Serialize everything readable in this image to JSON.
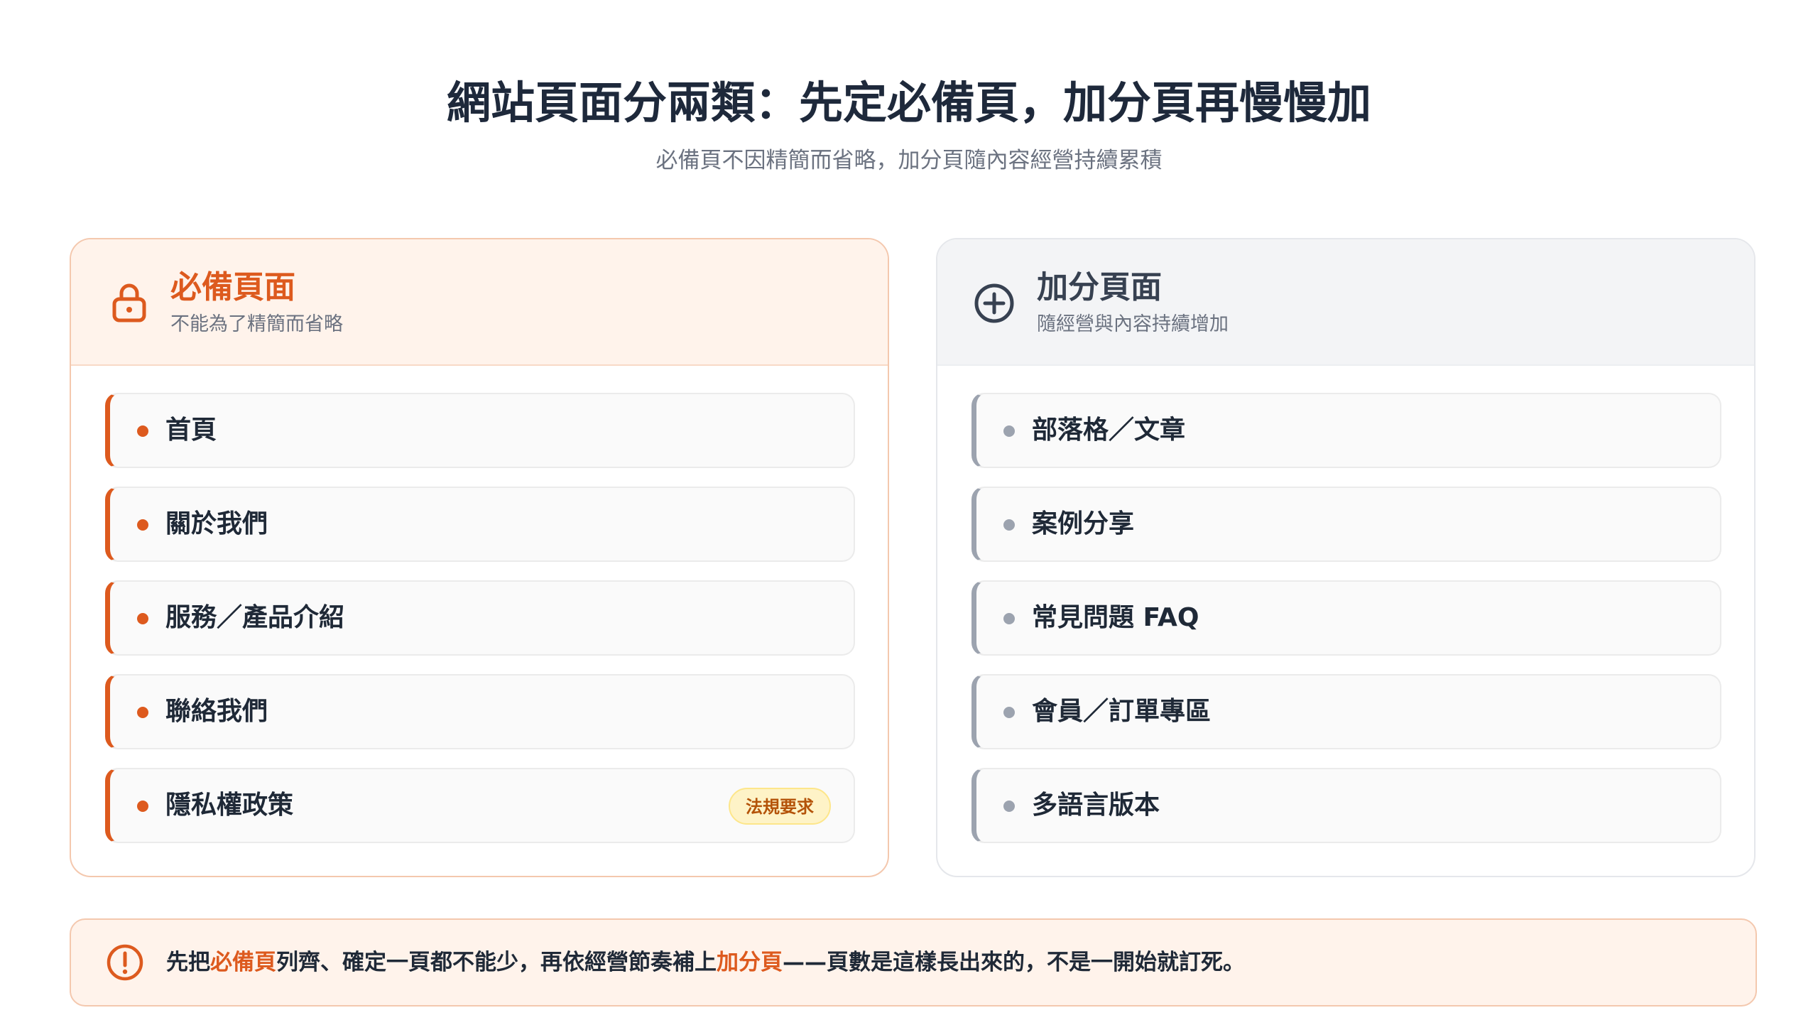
{
  "header": {
    "title": "網站頁面分兩類：先定必備頁，加分頁再慢慢加",
    "subtitle": "必備頁不因精簡而省略，加分頁隨內容經營持續累積"
  },
  "colors": {
    "accent": "#dd5a1e",
    "neutral": "#9ca3af",
    "badge": "#fef3c7"
  },
  "required": {
    "icon": "lock-icon",
    "title": "必備頁面",
    "subtitle": "不能為了精簡而省略",
    "items": [
      {
        "label": "首頁"
      },
      {
        "label": "關於我們"
      },
      {
        "label": "服務／產品介紹"
      },
      {
        "label": "聯絡我們"
      },
      {
        "label": "隱私權政策",
        "badge": "法規要求"
      }
    ]
  },
  "bonus": {
    "icon": "plus-circle-icon",
    "title": "加分頁面",
    "subtitle": "隨經營與內容持續增加",
    "items": [
      {
        "label": "部落格／文章"
      },
      {
        "label": "案例分享"
      },
      {
        "label": "常見問題 FAQ"
      },
      {
        "label": "會員／訂單專區"
      },
      {
        "label": "多語言版本"
      }
    ]
  },
  "callout": {
    "icon": "alert-circle-icon",
    "part1": "先把",
    "highlight1": "必備頁",
    "part2": "列齊、確定一頁都不能少，再依經營節奏補上",
    "highlight2": "加分頁",
    "part3": "——頁數是這樣長出來的，不是一開始就訂死。"
  }
}
